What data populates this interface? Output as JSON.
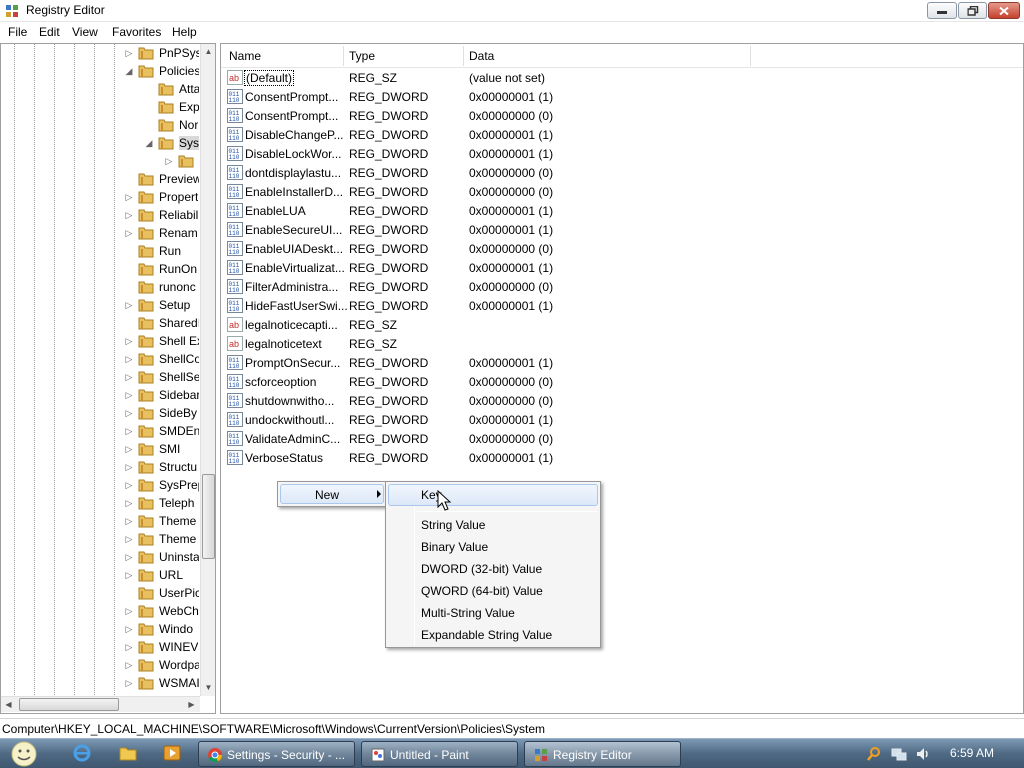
{
  "window": {
    "title": "Registry Editor"
  },
  "menu": [
    "File",
    "Edit",
    "View",
    "Favorites",
    "Help"
  ],
  "tree": {
    "items": [
      {
        "label": "PnPSys",
        "expander": "closed",
        "level": 1
      },
      {
        "label": "Policies",
        "expander": "open",
        "level": 1
      },
      {
        "label": "Atta",
        "expander": "none",
        "level": 2
      },
      {
        "label": "Exp",
        "expander": "none",
        "level": 2
      },
      {
        "label": "Nor",
        "expander": "none",
        "level": 2
      },
      {
        "label": "Syst",
        "expander": "open",
        "level": 2,
        "selected": true
      },
      {
        "label": "",
        "expander": "closed",
        "level": 3
      },
      {
        "label": "Preview",
        "expander": "none",
        "level": 1
      },
      {
        "label": "Propert",
        "expander": "closed",
        "level": 1
      },
      {
        "label": "Reliabil",
        "expander": "closed",
        "level": 1
      },
      {
        "label": "Renam",
        "expander": "closed",
        "level": 1
      },
      {
        "label": "Run",
        "expander": "none",
        "level": 1
      },
      {
        "label": "RunOn",
        "expander": "none",
        "level": 1
      },
      {
        "label": "runonc",
        "expander": "none",
        "level": 1
      },
      {
        "label": "Setup",
        "expander": "closed",
        "level": 1
      },
      {
        "label": "SharedI",
        "expander": "none",
        "level": 1
      },
      {
        "label": "Shell Ex",
        "expander": "closed",
        "level": 1
      },
      {
        "label": "ShellCo",
        "expander": "closed",
        "level": 1
      },
      {
        "label": "ShellSe",
        "expander": "closed",
        "level": 1
      },
      {
        "label": "Sidebar",
        "expander": "closed",
        "level": 1
      },
      {
        "label": "SideBy",
        "expander": "closed",
        "level": 1
      },
      {
        "label": "SMDEn",
        "expander": "closed",
        "level": 1
      },
      {
        "label": "SMI",
        "expander": "closed",
        "level": 1
      },
      {
        "label": "Structu",
        "expander": "closed",
        "level": 1
      },
      {
        "label": "SysPrep",
        "expander": "closed",
        "level": 1
      },
      {
        "label": "Teleph",
        "expander": "closed",
        "level": 1
      },
      {
        "label": "Theme",
        "expander": "closed",
        "level": 1
      },
      {
        "label": "Theme",
        "expander": "closed",
        "level": 1
      },
      {
        "label": "Uninsta",
        "expander": "closed",
        "level": 1
      },
      {
        "label": "URL",
        "expander": "closed",
        "level": 1
      },
      {
        "label": "UserPic",
        "expander": "none",
        "level": 1
      },
      {
        "label": "WebCh",
        "expander": "closed",
        "level": 1
      },
      {
        "label": "Windo",
        "expander": "closed",
        "level": 1
      },
      {
        "label": "WINEV",
        "expander": "closed",
        "level": 1
      },
      {
        "label": "Wordpa",
        "expander": "closed",
        "level": 1
      },
      {
        "label": "WSMAI",
        "expander": "closed",
        "level": 1
      }
    ]
  },
  "values_pane": {
    "columns": {
      "name": "Name",
      "type": "Type",
      "data": "Data"
    },
    "rows": [
      {
        "icon": "string-value-icon",
        "name": "(Default)",
        "type": "REG_SZ",
        "data": "(value not set)"
      },
      {
        "icon": "dword-value-icon",
        "name": "ConsentPrompt...",
        "type": "REG_DWORD",
        "data": "0x00000001 (1)"
      },
      {
        "icon": "dword-value-icon",
        "name": "ConsentPrompt...",
        "type": "REG_DWORD",
        "data": "0x00000000 (0)"
      },
      {
        "icon": "dword-value-icon",
        "name": "DisableChangeP...",
        "type": "REG_DWORD",
        "data": "0x00000001 (1)"
      },
      {
        "icon": "dword-value-icon",
        "name": "DisableLockWor...",
        "type": "REG_DWORD",
        "data": "0x00000001 (1)"
      },
      {
        "icon": "dword-value-icon",
        "name": "dontdisplaylastu...",
        "type": "REG_DWORD",
        "data": "0x00000000 (0)"
      },
      {
        "icon": "dword-value-icon",
        "name": "EnableInstallerD...",
        "type": "REG_DWORD",
        "data": "0x00000000 (0)"
      },
      {
        "icon": "dword-value-icon",
        "name": "EnableLUA",
        "type": "REG_DWORD",
        "data": "0x00000001 (1)"
      },
      {
        "icon": "dword-value-icon",
        "name": "EnableSecureUI...",
        "type": "REG_DWORD",
        "data": "0x00000001 (1)"
      },
      {
        "icon": "dword-value-icon",
        "name": "EnableUIADeskt...",
        "type": "REG_DWORD",
        "data": "0x00000000 (0)"
      },
      {
        "icon": "dword-value-icon",
        "name": "EnableVirtualizat...",
        "type": "REG_DWORD",
        "data": "0x00000001 (1)"
      },
      {
        "icon": "dword-value-icon",
        "name": "FilterAdministra...",
        "type": "REG_DWORD",
        "data": "0x00000000 (0)"
      },
      {
        "icon": "dword-value-icon",
        "name": "HideFastUserSwi...",
        "type": "REG_DWORD",
        "data": "0x00000001 (1)"
      },
      {
        "icon": "string-value-icon",
        "name": "legalnoticecapti...",
        "type": "REG_SZ",
        "data": ""
      },
      {
        "icon": "string-value-icon",
        "name": "legalnoticetext",
        "type": "REG_SZ",
        "data": ""
      },
      {
        "icon": "dword-value-icon",
        "name": "PromptOnSecur...",
        "type": "REG_DWORD",
        "data": "0x00000001 (1)"
      },
      {
        "icon": "dword-value-icon",
        "name": "scforceoption",
        "type": "REG_DWORD",
        "data": "0x00000000 (0)"
      },
      {
        "icon": "dword-value-icon",
        "name": "shutdownwitho...",
        "type": "REG_DWORD",
        "data": "0x00000000 (0)"
      },
      {
        "icon": "dword-value-icon",
        "name": "undockwithoutl...",
        "type": "REG_DWORD",
        "data": "0x00000001 (1)"
      },
      {
        "icon": "dword-value-icon",
        "name": "ValidateAdminC...",
        "type": "REG_DWORD",
        "data": "0x00000000 (0)"
      },
      {
        "icon": "dword-value-icon",
        "name": "VerboseStatus",
        "type": "REG_DWORD",
        "data": "0x00000001 (1)"
      }
    ]
  },
  "context_menu": {
    "new_label": "New",
    "submenu": [
      "Key",
      "String Value",
      "Binary Value",
      "DWORD (32-bit) Value",
      "QWORD (64-bit) Value",
      "Multi-String Value",
      "Expandable String Value"
    ],
    "highlighted": "Key"
  },
  "status_bar": {
    "path": "Computer\\HKEY_LOCAL_MACHINE\\SOFTWARE\\Microsoft\\Windows\\CurrentVersion\\Policies\\System"
  },
  "taskbar": {
    "buttons": [
      {
        "icon": "chrome-icon",
        "label": "Settings - Security - ..."
      },
      {
        "icon": "paint-icon",
        "label": "Untitled - Paint"
      },
      {
        "icon": "regedit-icon",
        "label": "Registry Editor",
        "active": true
      }
    ],
    "quick_launch": [
      "internet-explorer-icon",
      "folder-icon",
      "media-player-icon"
    ],
    "tray_icons": [
      "search-icon",
      "network-icon",
      "volume-icon"
    ],
    "clock": "6:59 AM"
  },
  "colors": {
    "selection": "#d9d9d9",
    "menu_hover_border": "#aac8ee",
    "taskbar": "#506a84"
  }
}
